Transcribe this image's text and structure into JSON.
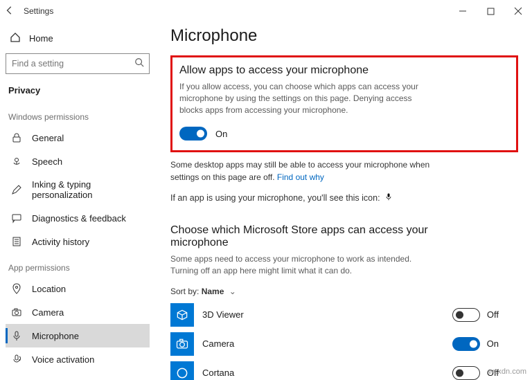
{
  "titlebar": {
    "title": "Settings"
  },
  "sidebar": {
    "home": "Home",
    "search_placeholder": "Find a setting",
    "category": "Privacy",
    "section_windows": "Windows permissions",
    "section_app": "App permissions",
    "windows_items": [
      {
        "label": "General"
      },
      {
        "label": "Speech"
      },
      {
        "label": "Inking & typing personalization"
      },
      {
        "label": "Diagnostics & feedback"
      },
      {
        "label": "Activity history"
      }
    ],
    "app_items": [
      {
        "label": "Location"
      },
      {
        "label": "Camera"
      },
      {
        "label": "Microphone"
      },
      {
        "label": "Voice activation"
      }
    ]
  },
  "main": {
    "page_title": "Microphone",
    "allow_heading": "Allow apps to access your microphone",
    "allow_desc": "If you allow access, you can choose which apps can access your microphone by using the settings on this page. Denying access blocks apps from accessing your microphone.",
    "allow_toggle_state": "On",
    "desktop_note_a": "Some desktop apps may still be able to access your microphone when settings on this page are off. ",
    "desktop_note_link": "Find out why",
    "using_note": "If an app is using your microphone, you'll see this icon:",
    "choose_heading": "Choose which Microsoft Store apps can access your microphone",
    "choose_desc": "Some apps need to access your microphone to work as intended. Turning off an app here might limit what it can do.",
    "sort_prefix": "Sort by:",
    "sort_value": "Name",
    "apps": [
      {
        "name": "3D Viewer",
        "state": "Off"
      },
      {
        "name": "Camera",
        "state": "On"
      },
      {
        "name": "Cortana",
        "state": "Off"
      }
    ]
  },
  "watermark": "wsxdn.com"
}
